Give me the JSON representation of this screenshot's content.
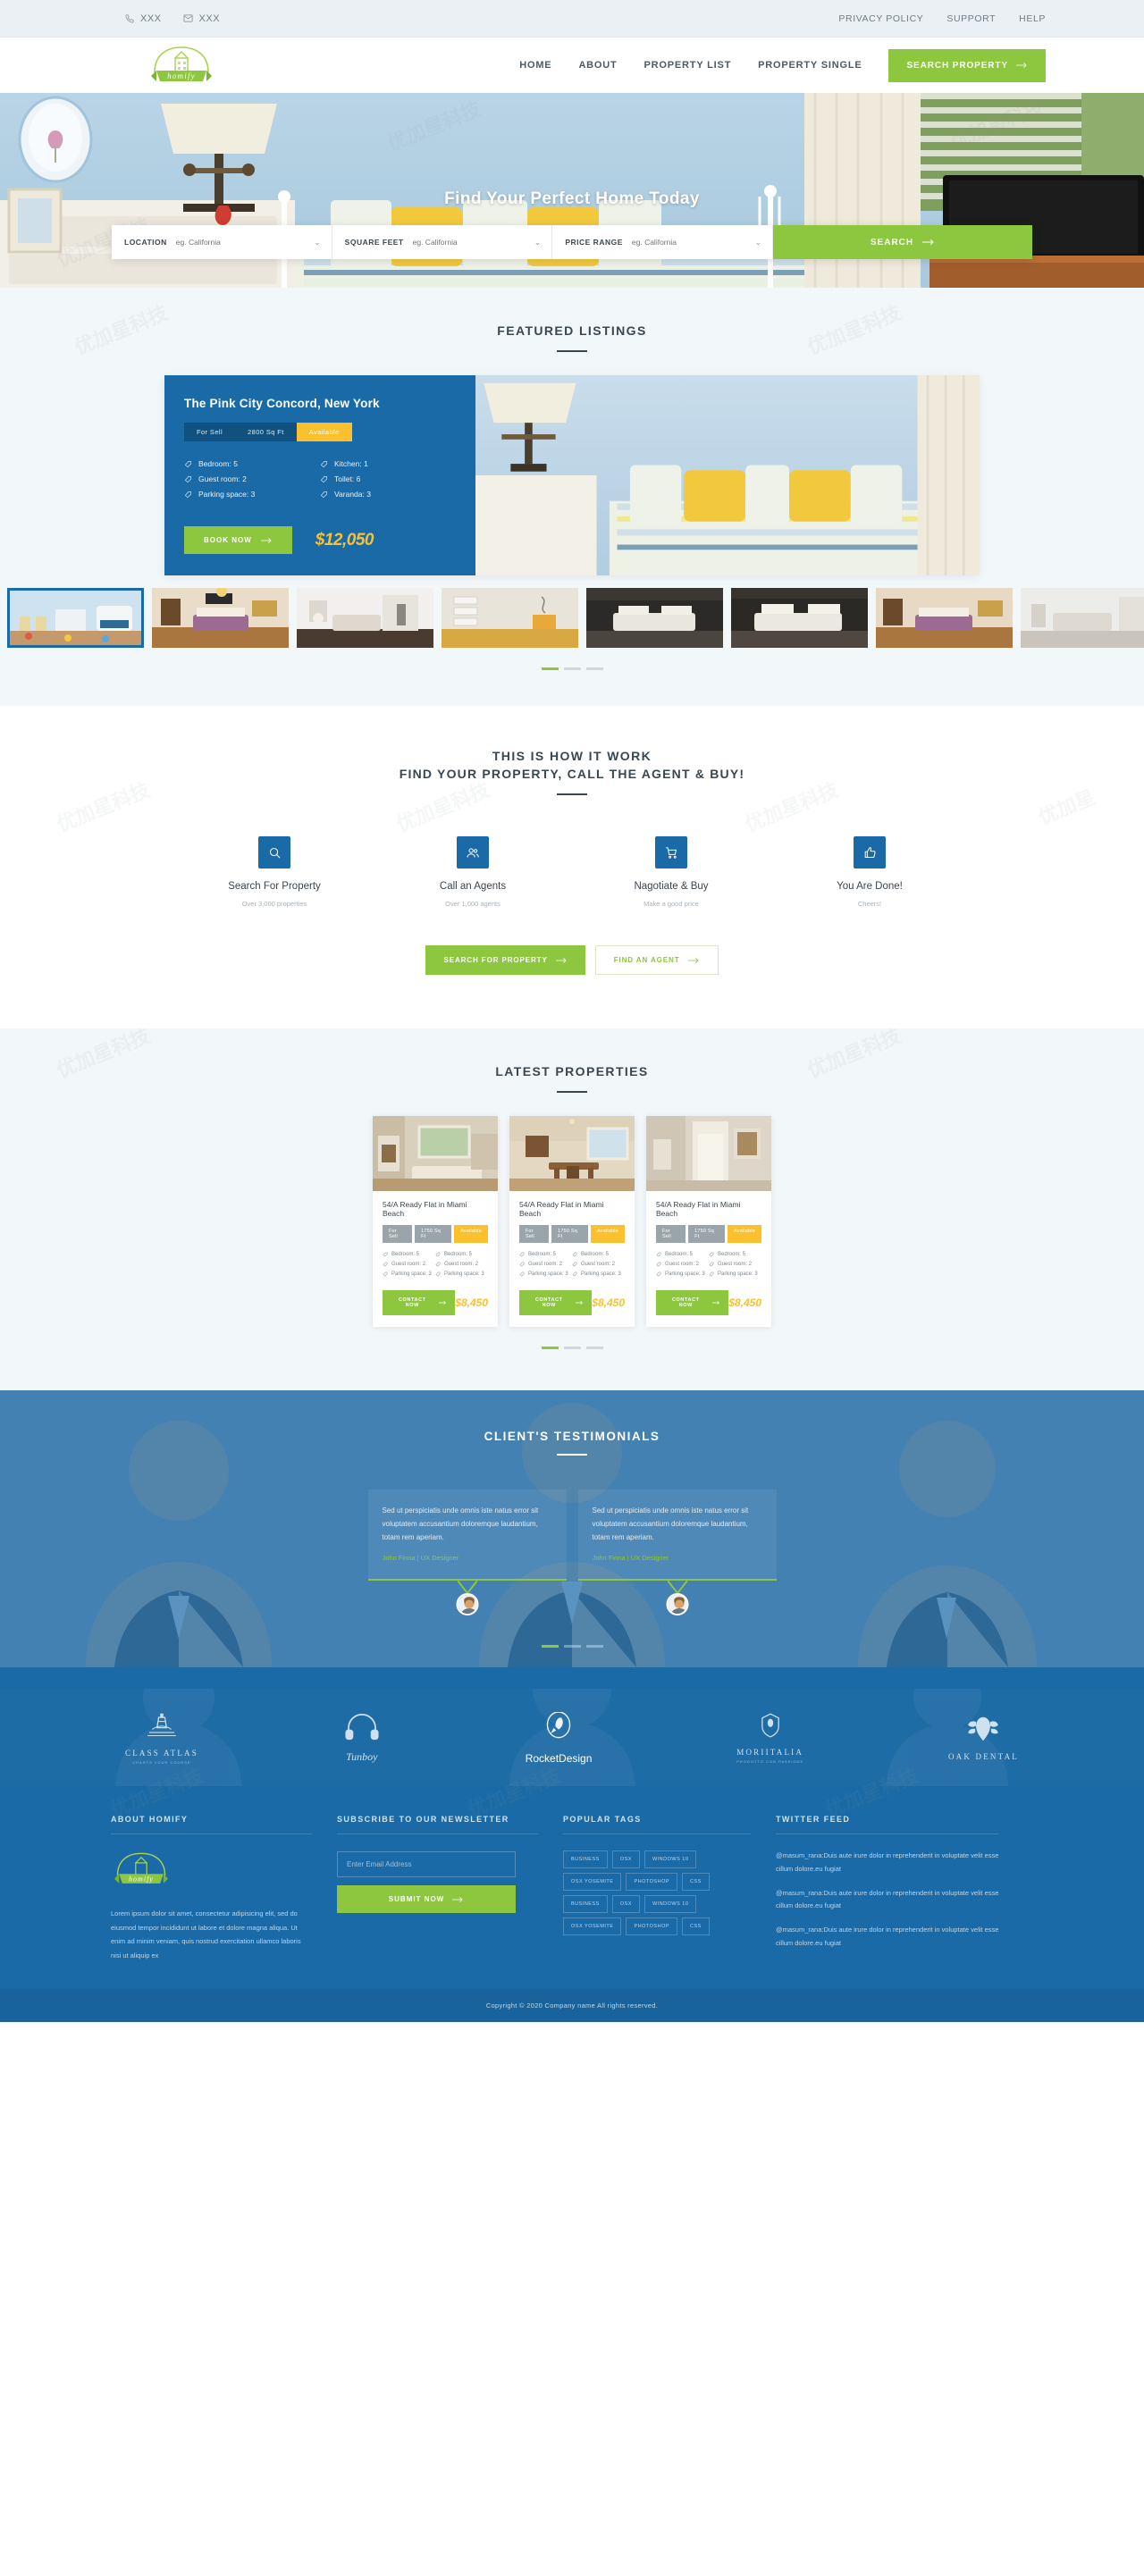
{
  "topbar": {
    "phone": "XXX",
    "email": "XXX",
    "links": [
      "PRIVACY POLICY",
      "SUPPORT",
      "HELP"
    ]
  },
  "header": {
    "logo_text": "homify",
    "nav": [
      "HOME",
      "ABOUT",
      "PROPERTY LIST",
      "PROPERTY SINGLE"
    ],
    "cta": "SEARCH PROPERTY"
  },
  "hero": {
    "title": "Find Your Perfect Home Today",
    "fields": [
      {
        "label": "LOCATION",
        "placeholder": "eg. California",
        "value": ""
      },
      {
        "label": "SQUARE FEET",
        "placeholder": "eg. California",
        "value": ""
      },
      {
        "label": "PRICE RANGE",
        "placeholder": "eg. California",
        "value": ""
      }
    ],
    "search_button": "SEARCH"
  },
  "featured": {
    "title": "FEATURED LISTINGS",
    "listing": {
      "name": "The Pink City Concord, New York",
      "pills": [
        "For Sell",
        "2800 Sq Ft",
        "Available"
      ],
      "specs_left": [
        "Bedroom: 5",
        "Guest room: 2",
        "Parking space: 3"
      ],
      "specs_right": [
        "Kitchen: 1",
        "Toilet: 6",
        "Varanda: 3"
      ],
      "book_button": "BOOK NOW",
      "price": "$12,050"
    },
    "thumbs": [
      "blue-kids-room",
      "purple-bedroom",
      "white-bedroom",
      "yellow-floor-room",
      "dark-bedroom-1",
      "dark-bedroom-2",
      "purple-bedroom-2",
      "grey-bedroom"
    ],
    "dots": 3,
    "active_dot": 0
  },
  "how": {
    "title": "THIS IS HOW IT WORK",
    "subtitle": "FIND YOUR PROPERTY, CALL THE AGENT & BUY!",
    "steps": [
      {
        "icon": "search-icon",
        "title": "Search For Property",
        "sub": "Over 3,000 properties"
      },
      {
        "icon": "agents-icon",
        "title": "Call an Agents",
        "sub": "Over 1,000 agents"
      },
      {
        "icon": "cart-icon",
        "title": "Nagotiate & Buy",
        "sub": "Make a good price"
      },
      {
        "icon": "thumbs-up-icon",
        "title": "You Are Done!",
        "sub": "Cheers!"
      }
    ],
    "cta_primary": "SEARCH FOR PROPERTY",
    "cta_secondary": "FIND AN AGENT"
  },
  "latest": {
    "title": "LATEST PROPERTIES",
    "dots": 3,
    "active_dot": 0,
    "cards": [
      {
        "name": "54/A Ready Flat in Miami Beach",
        "pills": [
          "For Sell",
          "1750 Sq Ft",
          "Available"
        ],
        "specs_left": [
          "Bedroom: 5",
          "Guest room: 2",
          "Parking space: 3"
        ],
        "specs_right": [
          "Bedroom: 5",
          "Guest room: 2",
          "Parking space: 3"
        ],
        "button": "CONTACT NOW",
        "price": "$8,450",
        "photo": "living-room-fireplace"
      },
      {
        "name": "54/A Ready Flat in Miami Beach",
        "pills": [
          "For Sell",
          "1750 Sq Ft",
          "Available"
        ],
        "specs_left": [
          "Bedroom: 5",
          "Guest room: 2",
          "Parking space: 3"
        ],
        "specs_right": [
          "Bedroom: 5",
          "Guest room: 2",
          "Parking space: 3"
        ],
        "button": "CONTACT NOW",
        "price": "$8,450",
        "photo": "dining-room"
      },
      {
        "name": "54/A Ready Flat in Miami Beach",
        "pills": [
          "For Sell",
          "1750 Sq Ft",
          "Available"
        ],
        "specs_left": [
          "Bedroom: 5",
          "Guest room: 2",
          "Parking space: 3"
        ],
        "specs_right": [
          "Bedroom: 5",
          "Guest room: 2",
          "Parking space: 3"
        ],
        "button": "CONTACT NOW",
        "price": "$8,450",
        "photo": "hallway"
      }
    ]
  },
  "testimonials": {
    "title": "CLIENT'S TESTIMONIALS",
    "dots": 3,
    "active_dot": 0,
    "items": [
      {
        "text": "Sed ut perspiciatis unde omnis iste natus error sit voluptatem accusantium doloremque laudantium, totam rem aperiam.",
        "author": "John Finna | UX Designer"
      },
      {
        "text": "Sed ut perspiciatis unde omnis iste natus error sit voluptatem accusantium doloremque laudantium, totam rem aperiam.",
        "author": "John Finna | UX Designer"
      }
    ]
  },
  "brands": [
    {
      "name": "CLASS ATLAS",
      "sub": "CHARTS YOUR COURSE",
      "icon": "lighthouse-icon"
    },
    {
      "name": "Tunboy",
      "sub": "",
      "icon": "headphones-icon"
    },
    {
      "name": "RocketDesign",
      "sub": "",
      "icon": "rocket-icon"
    },
    {
      "name": "MORIITALIA",
      "sub": "PRODOTTO CON PASSIONE",
      "icon": "shield-icon"
    },
    {
      "name": "OAK DENTAL",
      "sub": "",
      "icon": "oak-leaf-icon"
    }
  ],
  "footer": {
    "about": {
      "heading": "ABOUT HOMIFY",
      "logo_text": "homify",
      "text": "Lorem ipsum dolor sit amet, consectetur adipisicing elit, sed do eiusmod tempor incididunt ut labore et dolore magna aliqua. Ut enim ad minim veniam, quis nostrud exercitation ullamco laboris nisi ut aliquip ex"
    },
    "newsletter": {
      "heading": "SUBSCRIBE TO OUR NEWSLETTER",
      "placeholder": "Enter Email Address",
      "value": "",
      "button": "SUBMIT NOW"
    },
    "tags": {
      "heading": "POPULAR TAGS",
      "items": [
        "BUSINESS",
        "OSX",
        "WINDOWS 10",
        "OSX YOSEMITE",
        "PHOTOSHOP",
        "CSS",
        "BUSINESS",
        "OSX",
        "WINDOWS 10",
        "OSX YOSEMITE",
        "PHOTOSHOP",
        "CSS"
      ]
    },
    "twitter": {
      "heading": "TWITTER FEED",
      "items": [
        "@masum_rana:Duis aute irure dolor in reprehenderit in voluptate velit esse cillum dolore.eu fugiat",
        "@masum_rana:Duis aute irure dolor in reprehenderit in voluptate velit esse cillum dolore.eu fugiat",
        "@masum_rana:Duis aute irure dolor in reprehenderit in voluptate velit esse cillum dolore.eu fugiat"
      ]
    },
    "copyright": "Copyright © 2020 Company name All rights reserved."
  },
  "colors": {
    "green": "#8dc63f",
    "blue": "#1a6aa8",
    "yellow": "#fbc02d",
    "dark": "#3b474e",
    "light_bg": "#f2f7fa"
  }
}
